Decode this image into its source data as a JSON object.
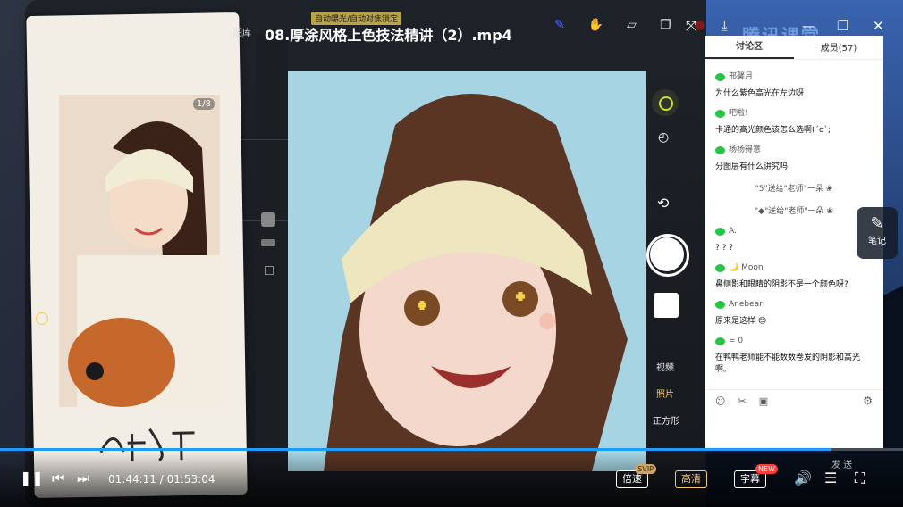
{
  "video": {
    "title": "08.厚涂风格上色技法精讲（2）.mp4",
    "camera_badge": "自动曝光/自动对焦锁定",
    "gallery_label": "图库",
    "photo_counter": "1/8",
    "modes": [
      "视频",
      "照片",
      "正方形"
    ],
    "active_mode": "照片"
  },
  "brand": "腾讯课堂",
  "panel": {
    "tabs": [
      {
        "label": "讨论区",
        "active": true
      },
      {
        "label": "成员(57)",
        "active": false
      }
    ],
    "messages": [
      {
        "user": "邢馨月",
        "text": "为什么紫色高光在左边呀"
      },
      {
        "user": "吧啦!",
        "text": "卡通的高光颜色该怎么选啊(´o`;"
      },
      {
        "user": "杨杨得意",
        "text": "分图层有什么讲究吗"
      },
      {
        "gift": "\"5\"送给\"老师\"一朵 ❀"
      },
      {
        "gift": "\"◆\"送给\"老师\"一朵 ❀"
      },
      {
        "user": "A.",
        "text": "? ? ?"
      },
      {
        "user": "🌙 Moon",
        "text": "鼻侧影和眼睛的阴影不是一个颜色呀?"
      },
      {
        "user": "Anebear",
        "text": "原来是这样 😊"
      },
      {
        "user": "= 0",
        "text": "在鸭鸭老师能不能数数卷发的阴影和高光啊。"
      }
    ],
    "send_label": "发 送"
  },
  "notes": {
    "label": "笔记"
  },
  "controls": {
    "current_time": "01:44:11",
    "duration": "01:53:04",
    "progress": 0.921,
    "speed_label": "倍速",
    "speed_tag": "SVIP",
    "quality_label": "高清",
    "subtitle_label": "字幕",
    "subtitle_tag": "NEW"
  },
  "colors": {
    "accent": "#1e9bff",
    "hd": "#f3c86a",
    "wechat": "#28c445"
  }
}
